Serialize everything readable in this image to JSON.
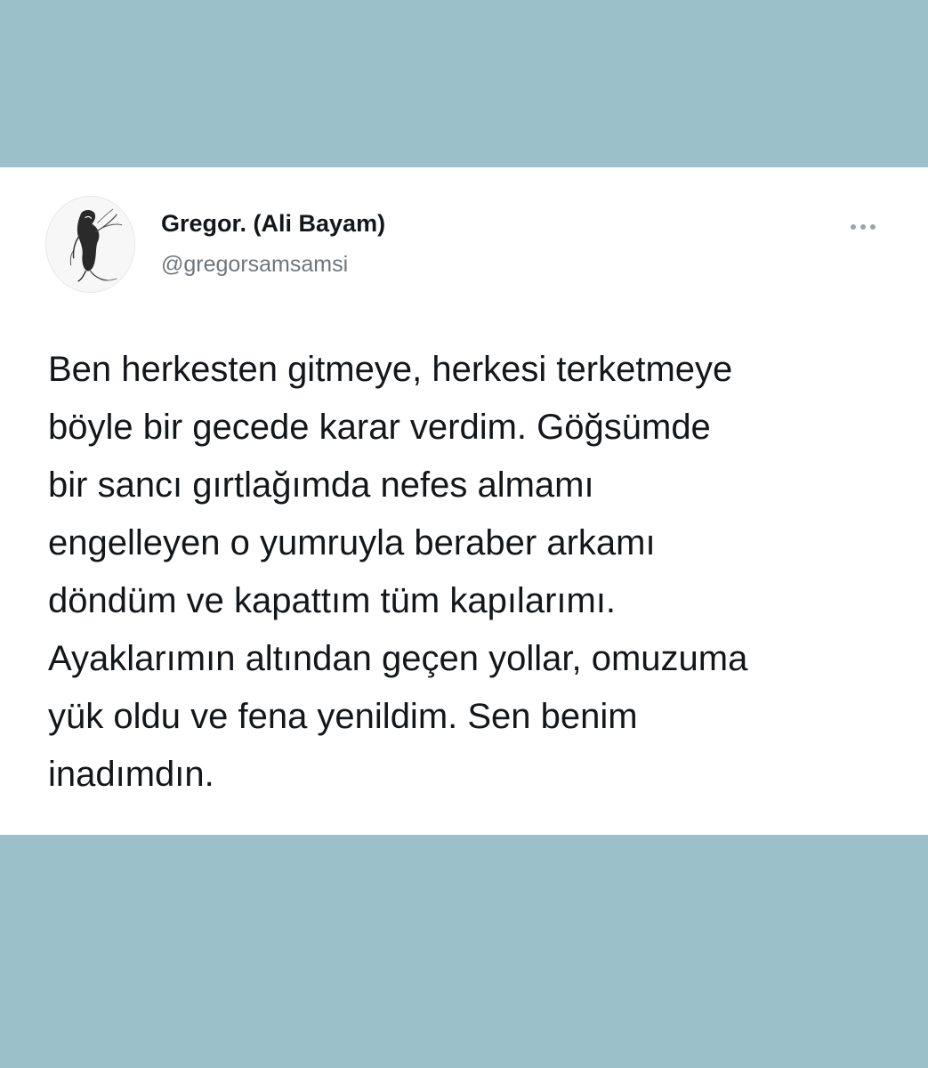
{
  "author": {
    "display_name": "Gregor. (Ali Bayam)",
    "handle": "@gregorsamsamsi",
    "avatar": "sketch-figure-avatar"
  },
  "actions": {
    "more_icon": "more-horizontal-icon"
  },
  "tweet": {
    "lines": [
      "Ben herkesten gitmeye, herkesi terketmeye",
      "böyle bir gecede karar verdim. Göğsümde",
      "bir sancı gırtlağımda nefes almamı",
      "engelleyen o yumruyla beraber arkamı",
      "döndüm ve kapattım tüm kapılarımı.",
      "Ayaklarımın altından geçen yollar, omuzuma",
      "yük oldu ve fena yenildim. Sen benim",
      "inadımdın."
    ]
  },
  "colors": {
    "background": "#9bc0ca",
    "card": "#ffffff",
    "text": "#14171a",
    "secondary_text": "#6e767d"
  }
}
